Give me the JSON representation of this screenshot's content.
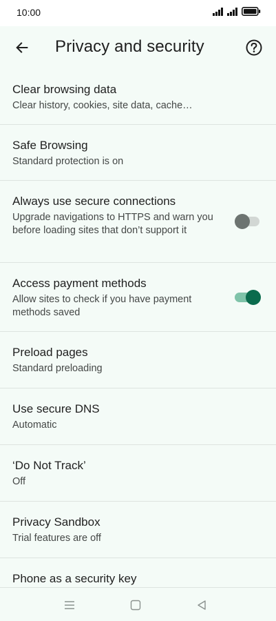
{
  "status": {
    "time": "10:00"
  },
  "header": {
    "title": "Privacy and security",
    "back_icon": "arrow-left-icon",
    "help_icon": "help-circle-icon"
  },
  "items": [
    {
      "title": "Clear browsing data",
      "subtitle": "Clear history, cookies, site data, cache…"
    },
    {
      "title": "Safe Browsing",
      "subtitle": "Standard protection is on"
    },
    {
      "title": "Always use secure connections",
      "subtitle": "Upgrade navigations to HTTPS and warn you before loading sites that don’t support it",
      "toggle": false
    },
    {
      "title": "Access payment methods",
      "subtitle": "Allow sites to check if you have payment methods saved",
      "toggle": true
    },
    {
      "title": "Preload pages",
      "subtitle": "Standard preloading"
    },
    {
      "title": "Use secure DNS",
      "subtitle": "Automatic"
    },
    {
      "title": "‘Do Not Track’",
      "subtitle": "Off"
    },
    {
      "title": "Privacy Sandbox",
      "subtitle": "Trial features are off"
    },
    {
      "title": "Phone as a security key",
      "subtitle": ""
    }
  ],
  "colors": {
    "background": "#f4fbf7",
    "toggle_on": "#0a6b4d",
    "toggle_on_track": "#7fc3a9",
    "toggle_off": "#6d7471"
  }
}
